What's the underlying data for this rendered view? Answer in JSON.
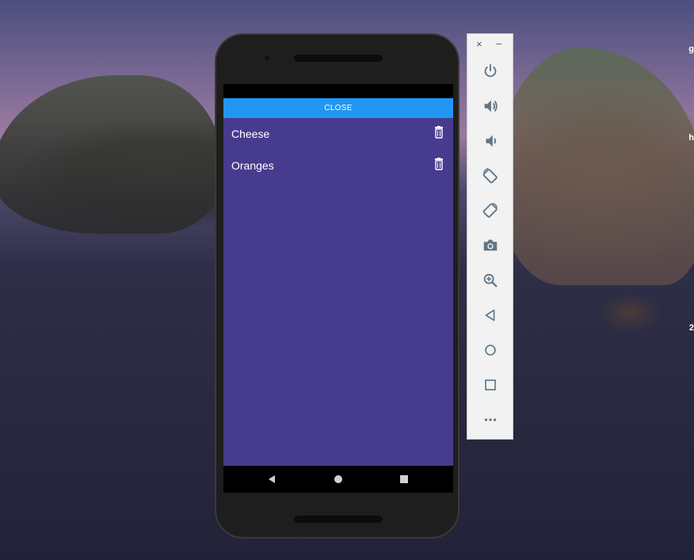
{
  "emulator": {
    "app": {
      "close_label": "CLOSE",
      "items": [
        {
          "label": "Cheese"
        },
        {
          "label": "Oranges"
        }
      ],
      "background_color": "#473b8e",
      "close_color": "#2196f3"
    },
    "nav": {
      "back_icon": "back-triangle-icon",
      "home_icon": "home-circle-icon",
      "overview_icon": "overview-square-icon"
    },
    "toolbar": {
      "close_glyph": "×",
      "minimize_glyph": "−",
      "buttons": [
        "power-icon",
        "volume-up-icon",
        "volume-down-icon",
        "rotate-left-icon",
        "rotate-right-icon",
        "camera-icon",
        "zoom-icon",
        "back-icon",
        "home-icon",
        "overview-icon",
        "more-icon"
      ],
      "icon_color": "#5f7585"
    }
  },
  "desktop": {
    "edge_text": [
      "g",
      "h",
      "2"
    ]
  }
}
